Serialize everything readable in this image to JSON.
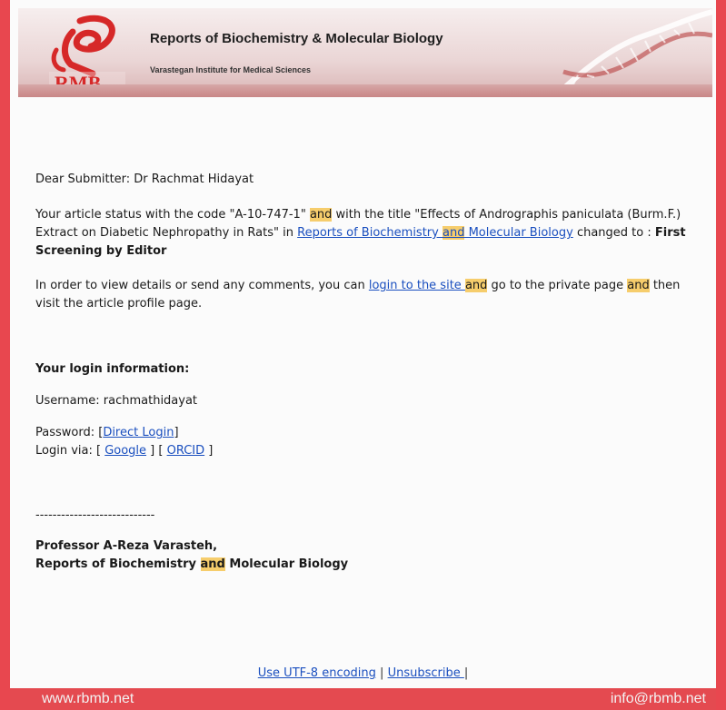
{
  "header": {
    "journal_title": "Reports of Biochemistry & Molecular Biology",
    "institute": "Varastegan Institute for Medical Sciences",
    "logo_text": "RMB"
  },
  "email": {
    "greeting": "Dear Submitter: Dr Rachmat Hidayat",
    "status_p1": "Your article status with the code \"A-10-747-1\" ",
    "and": "and",
    "status_p2": " with the title \"Effects of Andrographis paniculata (Burm.F.) Extract on Diabetic Nephropathy in Rats\" in ",
    "journal_link_a": "Reports of Biochemistry ",
    "journal_link_b": " Molecular Biology",
    "status_p3": " changed to : ",
    "status_value": "First Screening by Editor",
    "view_p1": "In order to view details or send any comments, you can ",
    "login_link": "login to the site ",
    "view_p2": " go to the private page ",
    "view_p3": " then visit the article profile page.",
    "login_heading": "Your login information:",
    "username_line": "Username: rachmathidayat",
    "password_label": "Password: [",
    "direct_login": "Direct Login",
    "bracket_close": "]",
    "login_via_label": "Login via: [ ",
    "google": "Google",
    "mid_brackets": " ] [ ",
    "orcid": "ORCID",
    "end_bracket": " ]",
    "divider": "----------------------------",
    "sig_name": "Professor A-Reza Varasteh,",
    "sig_journal_a": "Reports of Biochemistry ",
    "sig_journal_b": " Molecular Biology"
  },
  "footer": {
    "utf8": "Use UTF-8 encoding",
    "sep": " | ",
    "unsubscribe": "Unsubscribe ",
    "sep2": "|",
    "website": "www.rbmb.net",
    "email": "info@rbmb.net"
  },
  "colors": {
    "border": "#e8474f",
    "highlight": "#f6cd6c",
    "link": "#1a4fbf"
  }
}
